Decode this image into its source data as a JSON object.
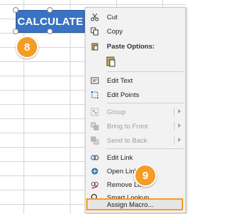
{
  "shape": {
    "label": "CALCULATE"
  },
  "steps": {
    "first": "8",
    "second": "9"
  },
  "menu": {
    "cut": "Cut",
    "copy": "Copy",
    "paste_options": "Paste Options:",
    "edit_text": "Edit Text",
    "edit_points": "Edit Points",
    "group": "Group",
    "bring_to_front": "Bring to Front",
    "send_to_back": "Send to Back",
    "edit_link": "Edit Link",
    "open_link": "Open Link",
    "remove_link": "Remove Link",
    "smart_lookup": "Smart Lookup",
    "assign_macro": "Assign Macro..."
  },
  "colors": {
    "accent": "#f39c26",
    "shape": "#3a72c4"
  }
}
